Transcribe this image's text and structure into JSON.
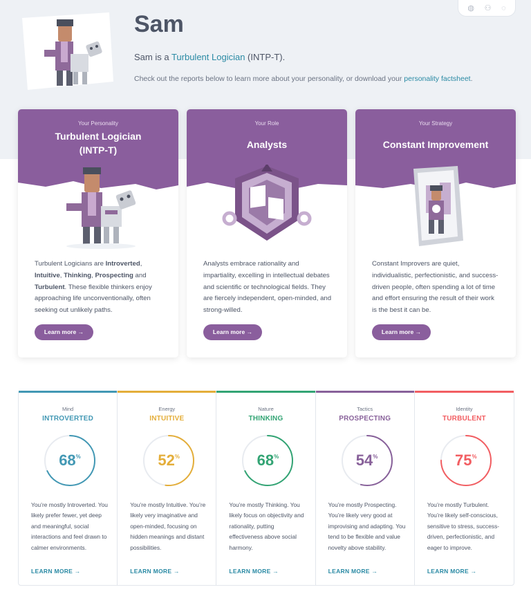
{
  "profile": {
    "name": "Sam",
    "type_prefix": "Sam is a ",
    "type_link": "Turbulent Logician",
    "type_suffix": " (INTP-T).",
    "sub_prefix": "Check out the reports below to learn more about your personality, or download your ",
    "sub_link": "personality factsheet",
    "sub_suffix": "."
  },
  "colors": {
    "purple": "#8a5e9d",
    "mind": "#4298b4",
    "energy": "#e4ae3a",
    "nature": "#33a474",
    "tactics": "#88619a",
    "identity": "#f25e62",
    "link": "#2a8aa4"
  },
  "cards": [
    {
      "eyebrow": "Your Personality",
      "title_line1": "Turbulent Logician",
      "title_line2": "(INTP-T)",
      "desc": {
        "t1": "Turbulent Logicians are ",
        "b1": "Introverted",
        "t2": ", ",
        "b2": "Intuitive",
        "t3": ", ",
        "b3": "Thinking",
        "t4": ", ",
        "b4": "Prospecting",
        "t5": " and ",
        "b5": "Turbulent",
        "t6": ". These flexible thinkers enjoy approaching life unconventionally, often seeking out unlikely paths."
      },
      "button": "Learn more →"
    },
    {
      "eyebrow": "Your Role",
      "title_line1": "Analysts",
      "desc_text": "Analysts embrace rationality and impartiality, excelling in intellectual debates and scientific or technological fields. They are fiercely independent, open-minded, and strong-willed.",
      "button": "Learn more →"
    },
    {
      "eyebrow": "Your Strategy",
      "title_line1": "Constant Improvement",
      "desc_text": "Constant Improvers are quiet, individualistic, perfectionistic, and success-driven people, often spending a lot of time and effort ensuring the result of their work is the best it can be.",
      "button": "Learn more →"
    }
  ],
  "traits": [
    {
      "label": "Mind",
      "result": "INTROVERTED",
      "percent": 68,
      "percent_sign": "%",
      "color": "#4298b4",
      "desc": "You’re mostly Introverted. You likely prefer fewer, yet deep and meaningful, social interactions and feel drawn to calmer environments.",
      "link": "LEARN MORE →"
    },
    {
      "label": "Energy",
      "result": "INTUITIVE",
      "percent": 52,
      "percent_sign": "%",
      "color": "#e4ae3a",
      "desc": "You’re mostly Intuitive. You’re likely very imaginative and open-minded, focusing on hidden meanings and distant possibilities.",
      "link": "LEARN MORE →"
    },
    {
      "label": "Nature",
      "result": "THINKING",
      "percent": 68,
      "percent_sign": "%",
      "color": "#33a474",
      "desc": "You’re mostly Thinking. You likely focus on objectivity and rationality, putting effectiveness above social harmony.",
      "link": "LEARN MORE →"
    },
    {
      "label": "Tactics",
      "result": "PROSPECTING",
      "percent": 54,
      "percent_sign": "%",
      "color": "#88619a",
      "desc": "You’re mostly Prospecting. You’re likely very good at improvising and adapting. You tend to be flexible and value novelty above stability.",
      "link": "LEARN MORE →"
    },
    {
      "label": "Identity",
      "result": "TURBULENT",
      "percent": 75,
      "percent_sign": "%",
      "color": "#f25e62",
      "desc": "You’re mostly Turbulent. You’re likely self-conscious, sensitive to stress, success-driven, perfectionistic, and eager to improve.",
      "link": "LEARN MORE →"
    }
  ],
  "top_actions": [
    "globe-icon",
    "add-user-icon",
    "chat-icon"
  ]
}
